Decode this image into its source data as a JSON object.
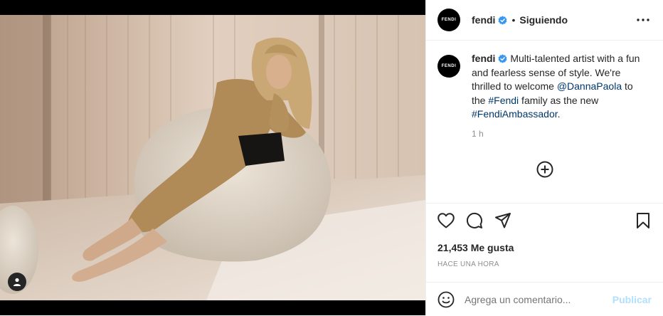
{
  "post": {
    "account": {
      "username": "fendi",
      "avatar_text": "FENDI",
      "verified": true,
      "follow_status": "Siguiendo",
      "separator": "•"
    },
    "caption": {
      "username": "fendi",
      "text_1": " Multi-talented artist with a fun and fearless sense of style. We're thrilled to welcome ",
      "mention": "@DannaPaola",
      "text_2": " to the ",
      "hashtag_1": "#Fendi",
      "text_3": " family as the new ",
      "hashtag_2": "#FendiAmbassador",
      "text_4": ".",
      "time": "1 h"
    },
    "likes": "21,453 Me gusta",
    "timestamp": "HACE UNA HORA",
    "comment": {
      "placeholder": "Agrega un comentario...",
      "publish_label": "Publicar"
    },
    "icons": {
      "more": "more-options-icon",
      "like": "heart-icon",
      "comment": "comment-icon",
      "share": "share-icon",
      "save": "bookmark-icon",
      "emoji": "emoji-icon",
      "tag": "user-tag-icon",
      "load_more": "plus-circle-icon"
    },
    "colors": {
      "verified": "#3897f0",
      "link": "#00376b",
      "publish_disabled": "#b2dffc",
      "secondary_text": "#8e8e8e"
    }
  }
}
